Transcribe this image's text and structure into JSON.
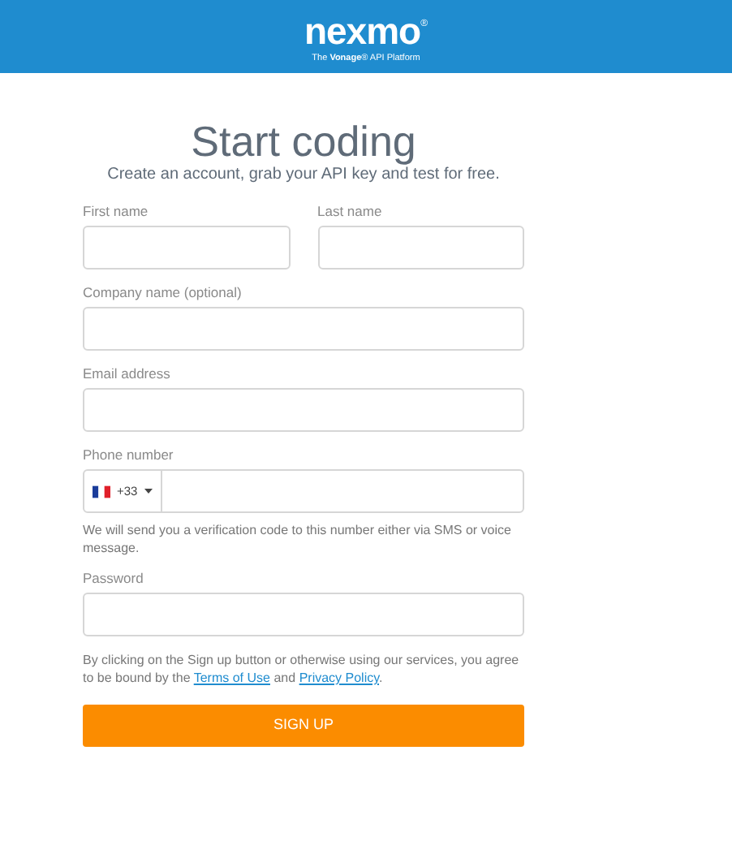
{
  "header": {
    "logo": "nexmo",
    "logo_mark": "®",
    "tagline": "The **Vonage**® API Platform"
  },
  "title": "Start coding",
  "subtitle": "Create an account, grab your API key and test for free.",
  "name_fields": [
    {
      "label": "First name"
    },
    {
      "label": "Last name"
    }
  ],
  "fields": [
    {
      "label": "Company name (optional)",
      "kind": "text"
    },
    {
      "label": "Email address",
      "kind": "text"
    },
    {
      "label": "Phone number",
      "kind": "phone",
      "country_code": "+33",
      "help": "We will send you a verification code to this number either via SMS or voice message."
    },
    {
      "label": "Password",
      "kind": "text"
    }
  ],
  "consent": {
    "before": "By clicking on the Sign up button or otherwise using our services, you agree to be bound by the",
    "terms": "Terms of Use",
    "middle": "and",
    "privacy": "Privacy Policy",
    "after": "."
  },
  "submit": "SIGN UP"
}
